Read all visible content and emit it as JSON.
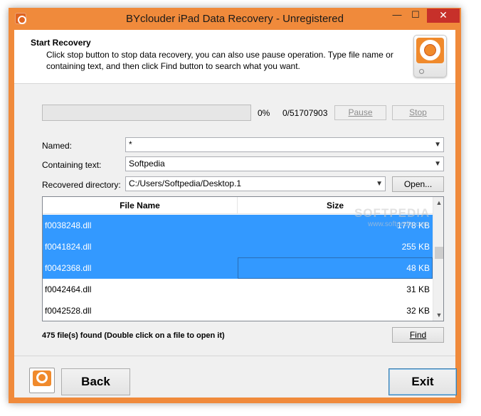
{
  "window": {
    "title": "BYclouder iPad Data Recovery - Unregistered",
    "controls": {
      "minimize": "—",
      "maximize": "☐",
      "close": "✕"
    }
  },
  "header": {
    "title": "Start Recovery",
    "description": "Click stop button to stop data recovery, you can also use pause operation. Type file name or containing text, and then click Find button to search what you want."
  },
  "progress": {
    "fraction": 0,
    "percent_label": "0%",
    "count_label": "0/51707903",
    "pause_label": "Pause",
    "stop_label": "Stop"
  },
  "fields": {
    "named_label": "Named:",
    "named_value": "*",
    "containing_label": "Containing text:",
    "containing_value": "Softpedia",
    "directory_label": "Recovered directory:",
    "directory_value": "C:/Users/Softpedia/Desktop.1",
    "open_label": "Open..."
  },
  "table": {
    "columns": [
      "File Name",
      "Size"
    ],
    "rows": [
      {
        "name": "f0038248.dll",
        "size": "1778 KB",
        "selected": true
      },
      {
        "name": "f0041824.dll",
        "size": "255 KB",
        "selected": true
      },
      {
        "name": "f0042368.dll",
        "size": "48 KB",
        "selected": true
      },
      {
        "name": "f0042464.dll",
        "size": "31 KB",
        "selected": false
      },
      {
        "name": "f0042528.dll",
        "size": "32 KB",
        "selected": false
      }
    ]
  },
  "status": {
    "text": "475 file(s) found (Double click on a file to open it)",
    "find_label": "Find"
  },
  "footer": {
    "back_label": "Back",
    "exit_label": "Exit"
  },
  "watermark": {
    "brand": "SOFTPEDIA",
    "url": "www.softpedia.com"
  },
  "colors": {
    "title_bar": "#f08a3b",
    "selection": "#3399ff",
    "close_button": "#c7302a"
  },
  "icons": [
    "app-logo-icon",
    "lifebuoy-icon",
    "chevron-down-icon",
    "minimize-icon",
    "maximize-icon",
    "close-icon",
    "scroll-up-icon",
    "scroll-down-icon"
  ]
}
